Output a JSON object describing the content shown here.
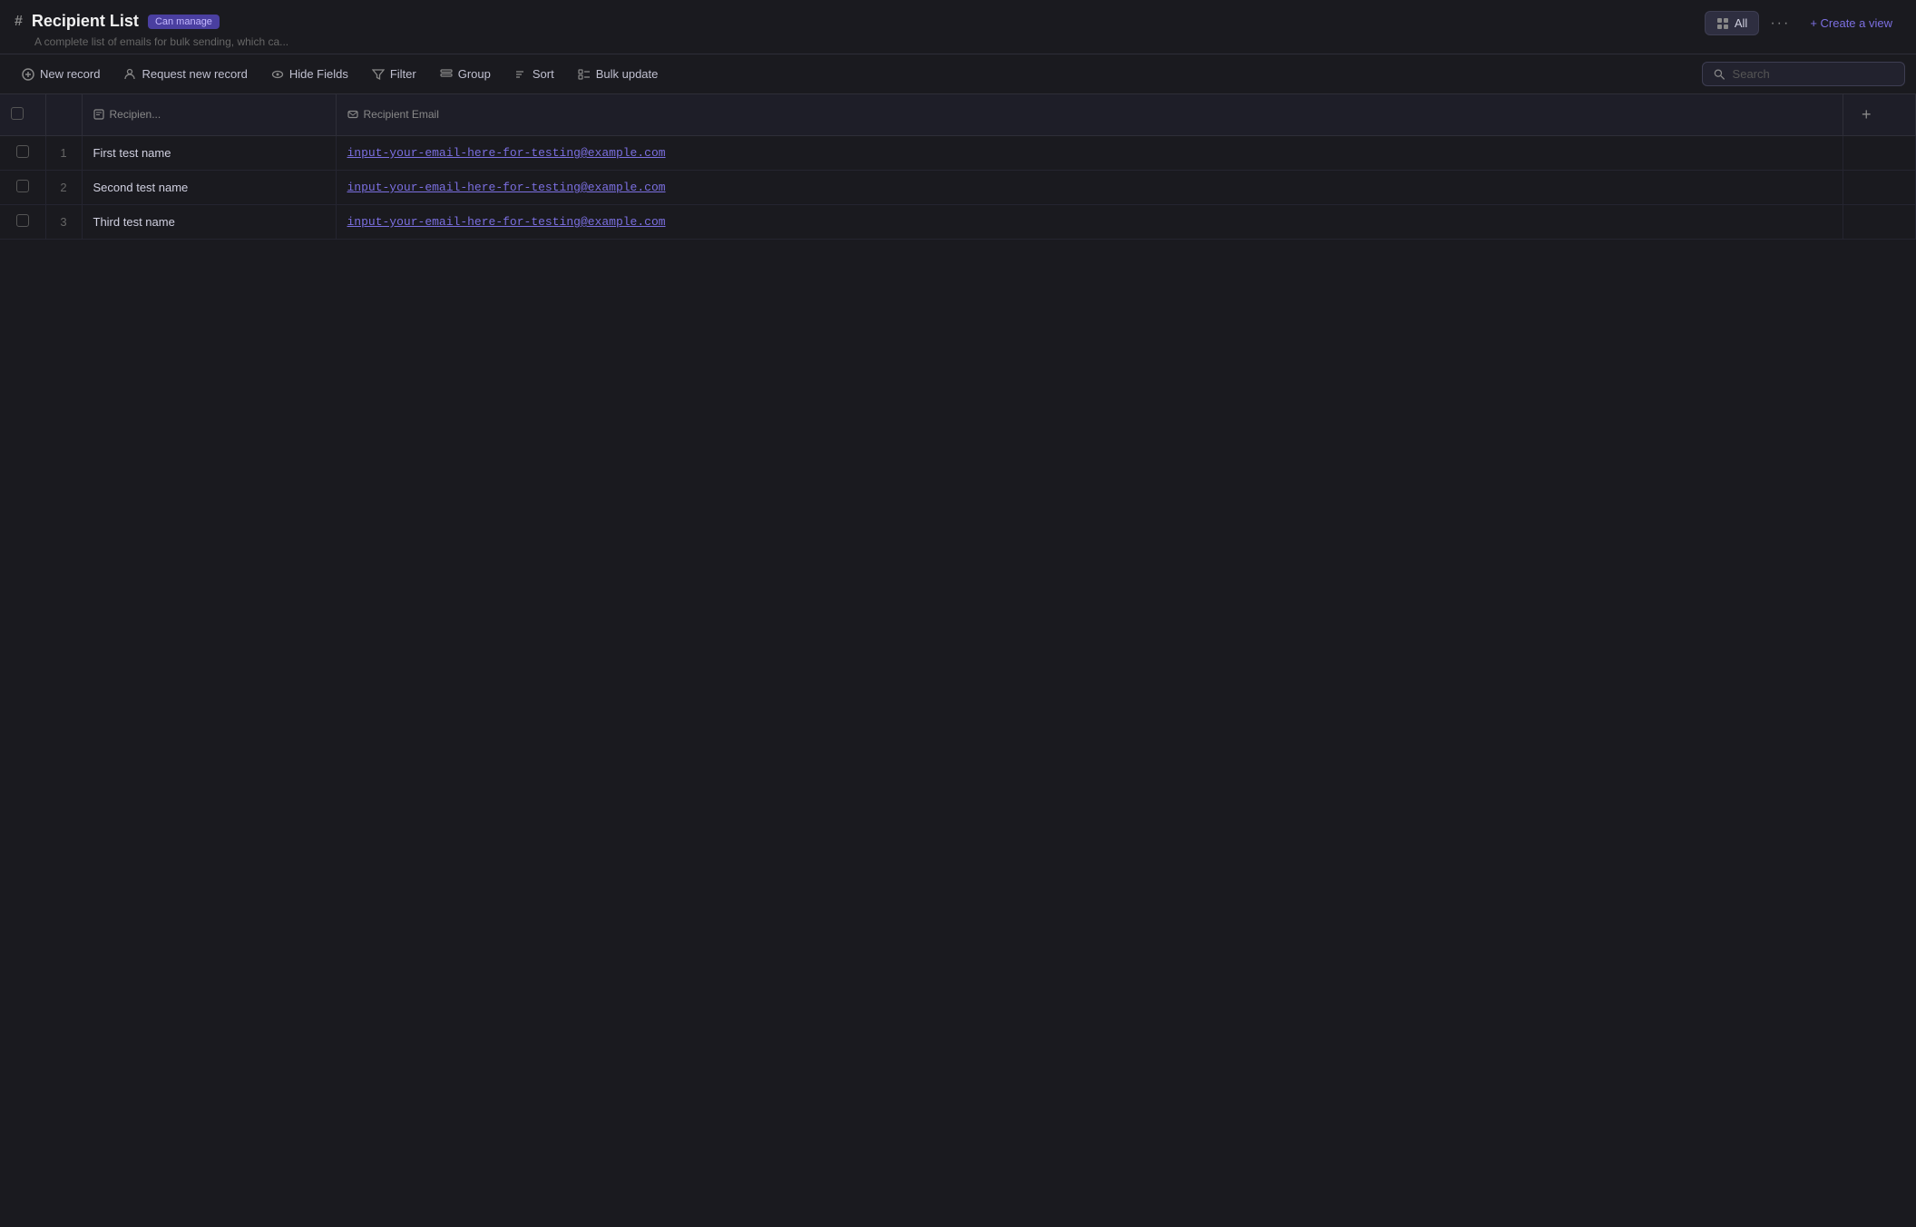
{
  "header": {
    "hash": "#",
    "title": "Recipient List",
    "badge": "Can manage",
    "subtitle": "A complete list of emails for bulk sending, which ca...",
    "tabs": [
      {
        "label": "All",
        "active": true
      }
    ],
    "more_label": "···",
    "create_view_label": "+ Create a view"
  },
  "toolbar": {
    "new_record": "New record",
    "request_record": "Request new record",
    "hide_fields": "Hide Fields",
    "filter": "Filter",
    "group": "Group",
    "sort": "Sort",
    "bulk_update": "Bulk update",
    "search_placeholder": "Search"
  },
  "table": {
    "columns": [
      {
        "label": "Recipien...",
        "icon": "text-icon"
      },
      {
        "label": "Recipient Email",
        "icon": "email-icon"
      }
    ],
    "rows": [
      {
        "id": 1,
        "num": "1",
        "name": "First test name",
        "email": "input-your-email-here-for-testing@example.com"
      },
      {
        "id": 2,
        "num": "2",
        "name": "Second test name",
        "email": "input-your-email-here-for-testing@example.com"
      },
      {
        "id": 3,
        "num": "3",
        "name": "Third test name",
        "email": "input-your-email-here-for-testing@example.com"
      }
    ]
  }
}
